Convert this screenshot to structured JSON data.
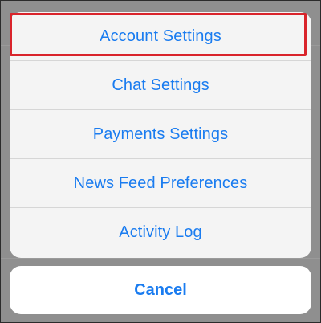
{
  "action_sheet": {
    "items": [
      {
        "label": "Account Settings"
      },
      {
        "label": "Chat Settings"
      },
      {
        "label": "Payments Settings"
      },
      {
        "label": "News Feed Preferences"
      },
      {
        "label": "Activity Log"
      }
    ],
    "cancel_label": "Cancel"
  },
  "colors": {
    "accent": "#1a7cf0",
    "highlight": "#d9242b",
    "overlay": "#8f8f8f"
  }
}
